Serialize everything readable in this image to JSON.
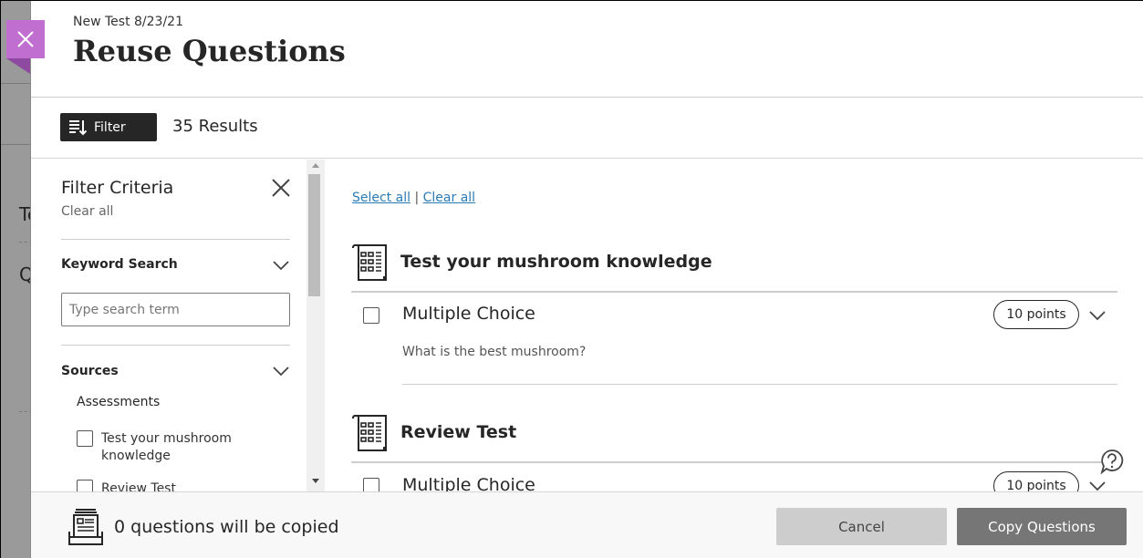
{
  "header": {
    "subtitle": "New Test 8/23/21",
    "title": "Reuse Questions"
  },
  "toolbar": {
    "filter_label": "Filter",
    "results_count": "35 Results"
  },
  "filter_pane": {
    "title": "Filter Criteria",
    "clear_all": "Clear all",
    "keyword_section": "Keyword Search",
    "search_placeholder": "Type search term",
    "search_value": "",
    "sources_section": "Sources",
    "assessments_label": "Assessments",
    "sources": [
      {
        "label": "Test your mushroom knowledge",
        "checked": false
      },
      {
        "label": "Review Test",
        "checked": false
      }
    ]
  },
  "main": {
    "select_all": "Select all",
    "separator": "|",
    "clear_all": "Clear all",
    "groups": [
      {
        "title": "Test your mushroom knowledge",
        "questions": [
          {
            "type": "Multiple Choice",
            "points": "10 points",
            "text": "What is the best mushroom?",
            "checked": false
          }
        ]
      },
      {
        "title": "Review Test",
        "questions": [
          {
            "type": "Multiple Choice",
            "points": "10 points",
            "text": "",
            "checked": false
          }
        ]
      }
    ]
  },
  "footer": {
    "status": "0 questions will be copied",
    "cancel_label": "Cancel",
    "copy_label": "Copy Questions"
  },
  "background": {
    "peek_text_1": "Te",
    "peek_text_2": "Q"
  },
  "colors": {
    "close_tab": "#c16ed1",
    "link": "#2b7bb5",
    "filter_button": "#262626",
    "copy_button": "#767676",
    "cancel_button": "#cdcdcd"
  }
}
